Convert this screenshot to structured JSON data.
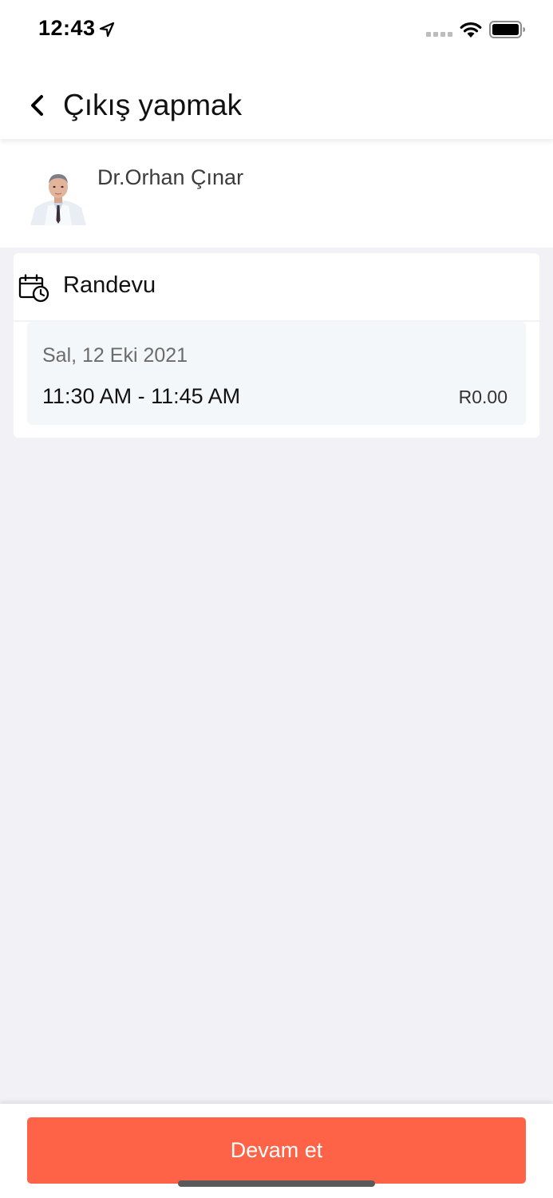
{
  "status_bar": {
    "time": "12:43",
    "icons": [
      "location-arrow-icon",
      "signal-icon",
      "wifi-icon",
      "battery-icon"
    ]
  },
  "header": {
    "back_icon": "chevron-left-icon",
    "title": "Çıkış yapmak"
  },
  "doctor": {
    "name": "Dr.Orhan Çınar"
  },
  "appointment": {
    "icon": "calendar-clock-icon",
    "title": "Randevu",
    "date": "Sal, 12 Eki 2021",
    "time_range": "11:30 AM - 11:45 AM",
    "price": "R0.00"
  },
  "footer": {
    "continue_label": "Devam et"
  },
  "colors": {
    "accent": "#ff6347",
    "background": "#f2f2f6",
    "slot_background": "#f4f7f9"
  }
}
